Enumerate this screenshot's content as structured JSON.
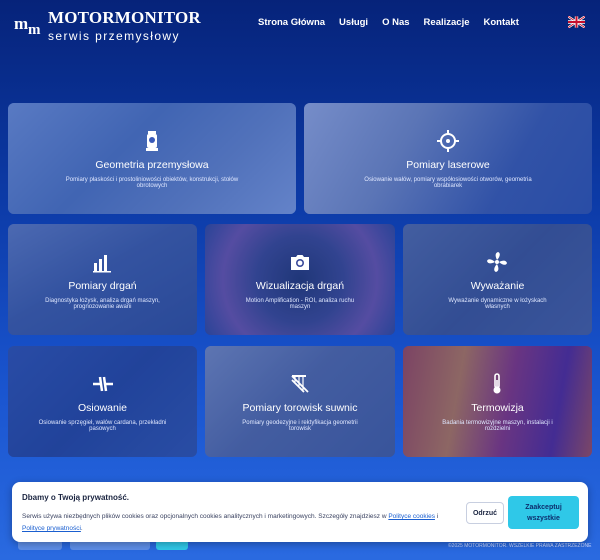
{
  "brand": {
    "title": "MOTORMONITOR",
    "subtitle": "serwis przemysłowy"
  },
  "nav": {
    "items": [
      "Strona Główna",
      "Usługi",
      "O Nas",
      "Realizacje",
      "Kontakt"
    ]
  },
  "language_flag": "uk-flag-icon",
  "cards": [
    {
      "title": "Geometria przemysłowa",
      "desc": "Pomiary płaskości i prostoliniowości obiektów, konstrukcji, stołów obrotowych",
      "icon": "surveying-instrument-icon"
    },
    {
      "title": "Pomiary laserowe",
      "desc": "Osiowanie wałów, pomiary współosiowości otworów, geometria obrabiarek",
      "icon": "crosshair-icon"
    },
    {
      "title": "Pomiary drgań",
      "desc": "Diagnostyka łożysk, analiza drgań maszyn, prognozowanie awarii",
      "icon": "bar-chart-icon"
    },
    {
      "title": "Wizualizacja drgań",
      "desc": "Motion Amplification - ROI, analiza ruchu maszyn",
      "icon": "camera-icon"
    },
    {
      "title": "Wyważanie",
      "desc": "Wyważanie dynamiczne w łożyskach własnych",
      "icon": "fan-icon"
    },
    {
      "title": "Osiowanie",
      "desc": "Osiowanie sprzęgieł, wałów cardana, przekładni pasowych",
      "icon": "alignment-icon"
    },
    {
      "title": "Pomiary torowisk suwnic",
      "desc": "Pomiary geodezyjne i rektyfikacja geometrii torowisk",
      "icon": "crane-rail-icon"
    },
    {
      "title": "Termowizja",
      "desc": "Badania termowizyjne maszyn, instalacji i rozdzielni",
      "icon": "thermometer-icon"
    }
  ],
  "cookie": {
    "title": "Dbamy o Twoją prywatność.",
    "text_before": "Serwis używa niezbędnych plików cookies oraz opcjonalnych cookies analitycznych i marketingowych. Szczegóły znajdziesz w ",
    "link1": "Polityce cookies",
    "text_mid": " i ",
    "link2": "Polityce prywatności",
    "text_after": ".",
    "reject_label": "Odrzuć",
    "accept_label": "Zaakceptuj wszystkie"
  },
  "footer": {
    "copyright": "©2025 MOTORMONITOR. WSZELKIE PRAWA ZASTRZEŻONE"
  },
  "colors": {
    "accent": "#2fc8e8",
    "link": "#1a5fd0"
  }
}
